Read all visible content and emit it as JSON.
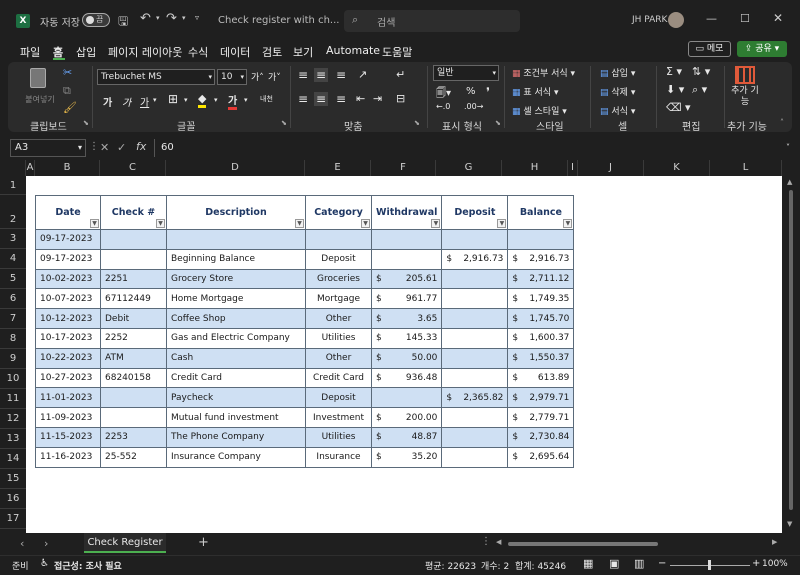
{
  "titlebar": {
    "autosave_label": "자동 저장",
    "autosave_toggle": "끔",
    "doc_title": "Check register with ch...",
    "search_placeholder": "검색",
    "user_name": "JH PARK"
  },
  "menu": [
    "파일",
    "홈",
    "삽입",
    "페이지 레이아웃",
    "수식",
    "데이터",
    "검토",
    "보기",
    "Automate",
    "도움말"
  ],
  "menu_active": "홈",
  "menu_right": {
    "memo": "메모",
    "share": "공유"
  },
  "ribbon": {
    "clipboard": {
      "paste": "붙여넣기",
      "label": "클립보드"
    },
    "font": {
      "name": "Trebuchet MS",
      "size": "10",
      "grow": "가˄",
      "shrink": "가˅",
      "bold": "가",
      "italic": "가",
      "underline": "가",
      "label": "글꼴",
      "phonetic": "내천"
    },
    "align": {
      "label": "맞춤"
    },
    "number": {
      "format": "일반",
      "label": "표시 형식"
    },
    "styles": {
      "cond": "조건부 서식",
      "table": "표 서식",
      "cell": "셀 스타일",
      "label": "스타일"
    },
    "cells": {
      "insert": "삽입",
      "delete": "삭제",
      "format": "서식",
      "label": "셀"
    },
    "edit": {
      "label": "편집"
    },
    "addins": {
      "btn": "추가 기능",
      "label": "추가 기능"
    }
  },
  "formula_bar": {
    "name_box": "A3",
    "fx": "fx",
    "value": "60"
  },
  "columns": [
    "A",
    "B",
    "C",
    "D",
    "E",
    "F",
    "G",
    "H",
    "I",
    "J",
    "K",
    "L"
  ],
  "rows": [
    "1",
    "2",
    "3",
    "4",
    "5",
    "6",
    "7",
    "8",
    "9",
    "10",
    "11",
    "12",
    "13",
    "14",
    "15",
    "16",
    "17"
  ],
  "table": {
    "headers": [
      "Date",
      "Check #",
      "Description",
      "Category",
      "Withdrawal",
      "Deposit",
      "Balance"
    ],
    "rows": [
      {
        "date": "09-17-2023",
        "check": "",
        "desc": "",
        "cat": "",
        "wd": "",
        "dep": "",
        "bal": ""
      },
      {
        "date": "09-17-2023",
        "check": "",
        "desc": "Beginning Balance",
        "cat": "Deposit",
        "wd": "",
        "dep": "2,916.73",
        "bal": "2,916.73"
      },
      {
        "date": "10-02-2023",
        "check": "2251",
        "desc": "Grocery Store",
        "cat": "Groceries",
        "wd": "205.61",
        "dep": "",
        "bal": "2,711.12"
      },
      {
        "date": "10-07-2023",
        "check": "67112449",
        "desc": "Home Mortgage",
        "cat": "Mortgage",
        "wd": "961.77",
        "dep": "",
        "bal": "1,749.35"
      },
      {
        "date": "10-12-2023",
        "check": "Debit",
        "desc": "Coffee Shop",
        "cat": "Other",
        "wd": "3.65",
        "dep": "",
        "bal": "1,745.70"
      },
      {
        "date": "10-17-2023",
        "check": "2252",
        "desc": "Gas and Electric Company",
        "cat": "Utilities",
        "wd": "145.33",
        "dep": "",
        "bal": "1,600.37"
      },
      {
        "date": "10-22-2023",
        "check": "ATM",
        "desc": "Cash",
        "cat": "Other",
        "wd": "50.00",
        "dep": "",
        "bal": "1,550.37"
      },
      {
        "date": "10-27-2023",
        "check": "68240158",
        "desc": "Credit Card",
        "cat": "Credit Card",
        "wd": "936.48",
        "dep": "",
        "bal": "613.89"
      },
      {
        "date": "11-01-2023",
        "check": "",
        "desc": "Paycheck",
        "cat": "Deposit",
        "wd": "",
        "dep": "2,365.82",
        "bal": "2,979.71"
      },
      {
        "date": "11-09-2023",
        "check": "",
        "desc": "Mutual fund investment",
        "cat": "Investment",
        "wd": "200.00",
        "dep": "",
        "bal": "2,779.71"
      },
      {
        "date": "11-15-2023",
        "check": "2253",
        "desc": "The Phone Company",
        "cat": "Utilities",
        "wd": "48.87",
        "dep": "",
        "bal": "2,730.84"
      },
      {
        "date": "11-16-2023",
        "check": "25-552",
        "desc": "Insurance Company",
        "cat": "Insurance",
        "wd": "35.20",
        "dep": "",
        "bal": "2,695.64"
      }
    ],
    "currency": "$"
  },
  "sheet_tabs": {
    "active": "Check Register",
    "add": "+"
  },
  "status": {
    "ready": "준비",
    "accessibility": "접근성: 조사 필요",
    "average": "평균: 22623",
    "count": "개수: 2",
    "sum": "합계: 45246",
    "zoom": "100%"
  },
  "colors": {
    "accent_green": "#2e7d32",
    "row_blue": "#cfe0f3",
    "header_text": "#1f3864"
  }
}
